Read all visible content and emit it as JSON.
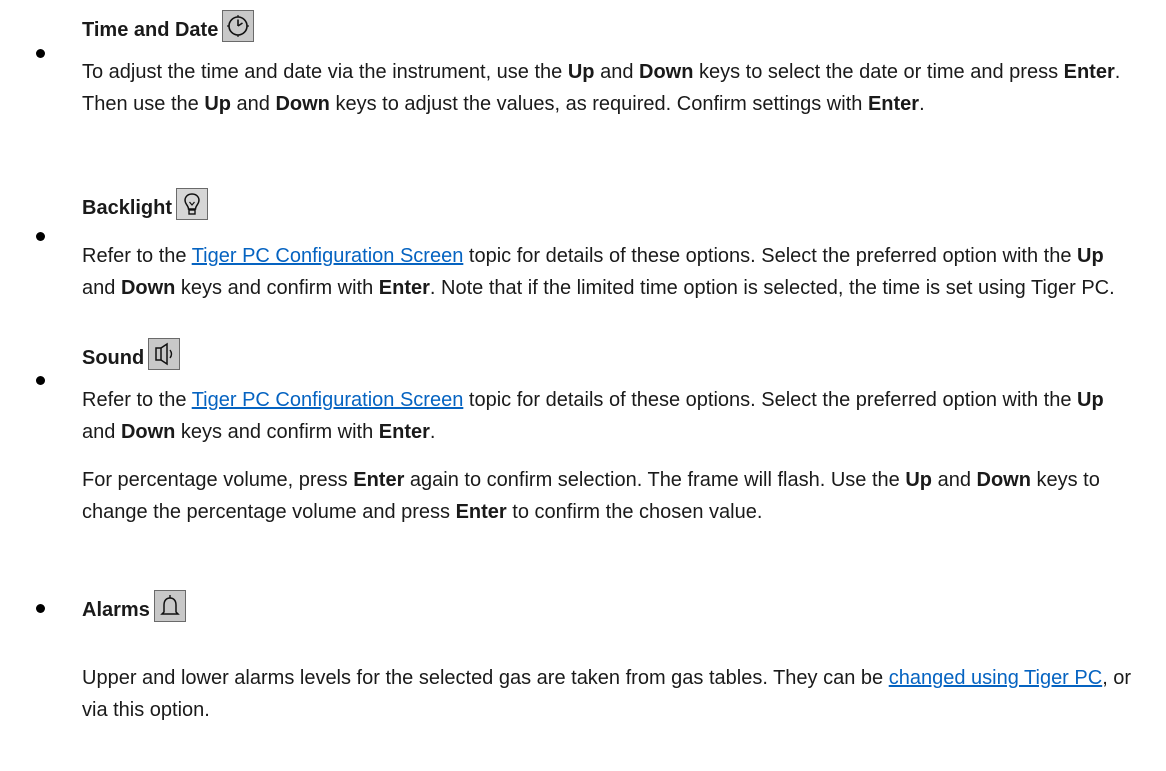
{
  "items": [
    {
      "label": "Time and Date",
      "icon": "clock-icon",
      "paragraphs": [
        [
          {
            "t": "To adjust the time and date via the instrument, use the "
          },
          {
            "t": "Up",
            "b": true
          },
          {
            "t": " and "
          },
          {
            "t": "Down",
            "b": true
          },
          {
            "t": " keys to select the date or time and press "
          },
          {
            "t": "Enter",
            "b": true
          },
          {
            "t": ". Then use the "
          },
          {
            "t": "Up",
            "b": true
          },
          {
            "t": " and "
          },
          {
            "t": "Down",
            "b": true
          },
          {
            "t": " keys to adjust the values, as required. Confirm settings with "
          },
          {
            "t": "Enter",
            "b": true
          },
          {
            "t": "."
          }
        ]
      ]
    },
    {
      "label": "Backlight",
      "icon": "lightbulb-icon",
      "paragraphs": [
        [
          {
            "t": "Refer to the "
          },
          {
            "t": "Tiger PC Configuration Screen",
            "link": true
          },
          {
            "t": " topic for details of these options. Select the preferred option with the "
          },
          {
            "t": "Up",
            "b": true
          },
          {
            "t": " and "
          },
          {
            "t": "Down",
            "b": true
          },
          {
            "t": " keys and confirm with "
          },
          {
            "t": "Enter",
            "b": true
          },
          {
            "t": ". Note that if the limited time option is selected, the time is set using Tiger PC."
          }
        ]
      ]
    },
    {
      "label": "Sound",
      "icon": "speaker-icon",
      "paragraphs": [
        [
          {
            "t": "Refer to the "
          },
          {
            "t": "Tiger PC Configuration Screen",
            "link": true
          },
          {
            "t": " topic for details of these options. Select the preferred option with the "
          },
          {
            "t": "Up",
            "b": true
          },
          {
            "t": " and "
          },
          {
            "t": "Down",
            "b": true
          },
          {
            "t": " keys and confirm with "
          },
          {
            "t": "Enter",
            "b": true
          },
          {
            "t": "."
          }
        ],
        [
          {
            "t": "For percentage volume, press "
          },
          {
            "t": "Enter",
            "b": true
          },
          {
            "t": " again to confirm selection. The frame will flash. Use the "
          },
          {
            "t": "Up",
            "b": true
          },
          {
            "t": " and "
          },
          {
            "t": "Down",
            "b": true
          },
          {
            "t": " keys to change the percentage volume and press "
          },
          {
            "t": "Enter",
            "b": true
          },
          {
            "t": " to confirm the chosen value."
          }
        ]
      ]
    },
    {
      "label": "Alarms",
      "icon": "bell-icon",
      "paragraphs": [
        [
          {
            "t": "Upper and lower alarms levels for the selected gas are taken from gas tables. They can be "
          },
          {
            "t": "changed using Tiger PC",
            "link": true
          },
          {
            "t": ", or via this option."
          }
        ]
      ]
    }
  ]
}
